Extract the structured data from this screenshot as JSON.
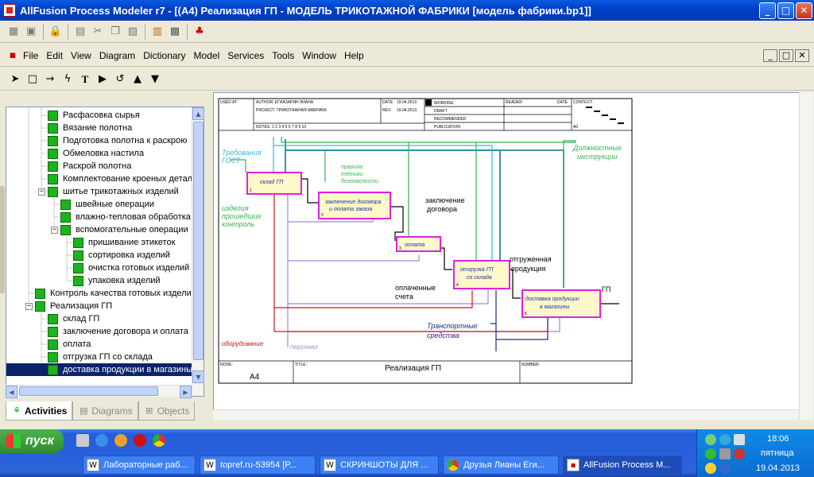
{
  "window": {
    "title": "AllFusion Process Modeler r7 - [(A4) Реализация ГП - МОДЕЛЬ ТРИКОТАЖНОЙ ФАБРИКИ  [модель фабрики.bp1]]",
    "min": "_",
    "max": "□",
    "close": "✕"
  },
  "menu": {
    "items": [
      "File",
      "Edit",
      "View",
      "Diagram",
      "Dictionary",
      "Model",
      "Services",
      "Tools",
      "Window",
      "Help"
    ]
  },
  "tree": {
    "items": [
      {
        "label": "Расфасовка  сырья"
      },
      {
        "label": "Вязание полотна"
      },
      {
        "label": "Подготовка  полотна к раскрою"
      },
      {
        "label": "Обмеловка  настила"
      },
      {
        "label": "Раскрой полотна"
      },
      {
        "label": "Комплектование  кроеных  деталей"
      },
      {
        "label": "шитье  трикотажных  изделий"
      },
      {
        "label": "швейные операции"
      },
      {
        "label": "влажно-тепловая   обработка"
      },
      {
        "label": "вспомогательные   операции"
      },
      {
        "label": "пришивание  этикеток"
      },
      {
        "label": "сортировка  изделий"
      },
      {
        "label": "очистка готовых    изделий"
      },
      {
        "label": "упаковка изделий"
      },
      {
        "label": "Контроль качества  готовых изделий"
      },
      {
        "label": "Реализация ГП"
      },
      {
        "label": "склад ГП"
      },
      {
        "label": "заключение договора  и оплата"
      },
      {
        "label": "оплата"
      },
      {
        "label": "отгрузка ГП  со склада"
      },
      {
        "label": "доставка продукции   в магазины"
      }
    ]
  },
  "tabs": [
    {
      "label": "Activities",
      "icon": "activities-icon"
    },
    {
      "label": "Diagrams",
      "icon": "diagrams-icon"
    },
    {
      "label": "Objects",
      "icon": "objects-icon"
    }
  ],
  "diagram": {
    "header": {
      "used_at": "USED AT:",
      "author": "AUTHOR:  ЕГИАЗАРЯН ЛИАНА",
      "project": "PROJECT:  ТРИКОТАЖНАЯ ФАБРИКА",
      "notes": "NOTES:  1  2  3  4  5  6  7  8  9  10",
      "date_label": "DATE:",
      "date": "19.04.2013",
      "rev_label": "REV:",
      "rev": "19.04.2013",
      "working": "WORKING",
      "draft": "DRAFT",
      "recommended": "RECOMMENDED",
      "publication": "PUBLICATION",
      "reader": "READER",
      "date2": "DATE",
      "context": "CONTEXT:",
      "ctx_node": "A0"
    },
    "footer": {
      "node_label": "NODE:",
      "node": "A4",
      "title_label": "TITLE:",
      "title": "Реализация ГП",
      "number_label": "NUMBER:"
    },
    "boxes": [
      {
        "label": "склад ГП",
        "num": "1"
      },
      {
        "label1": "заключение договора",
        "label2": "и оплата заказа",
        "num": "2"
      },
      {
        "label": "оплата",
        "num": "3"
      },
      {
        "label1": "отгрузка ГП",
        "label2": "со склада",
        "num": "4"
      },
      {
        "label1": "доставка продукции",
        "label2": "в магазины",
        "num": "5"
      }
    ],
    "labels": {
      "req1": "Требования",
      "req2": "ГОСТ",
      "rules1": "правила",
      "rules2": "техники",
      "rules3": "безопасности",
      "jobs1": "Должностные",
      "jobs2": "инструкции",
      "items1": "изделия",
      "items2": "прошедшие",
      "items3": "контроль",
      "contract1": "заключение",
      "contract2": "договора",
      "shipped1": "отгруженная",
      "shipped2": "продукция",
      "paid1": "оплаченные",
      "paid2": "счета",
      "gp": "ГП",
      "transport1": "Транспортные",
      "transport2": "средства",
      "equipment": "оборудование",
      "staff": "персонал"
    }
  },
  "taskbar": {
    "start": "пуск",
    "items": [
      {
        "label": "Лабораторные раб..."
      },
      {
        "label": "topref.ru-53954 [Р..."
      },
      {
        "label": "СКРИНШОТЫ ДЛЯ ..."
      },
      {
        "label": "Друзья Лианы Еги..."
      },
      {
        "label": "AllFusion Process M..."
      }
    ],
    "time": "18:06",
    "day": "пятница",
    "date": "19.04.2013"
  }
}
